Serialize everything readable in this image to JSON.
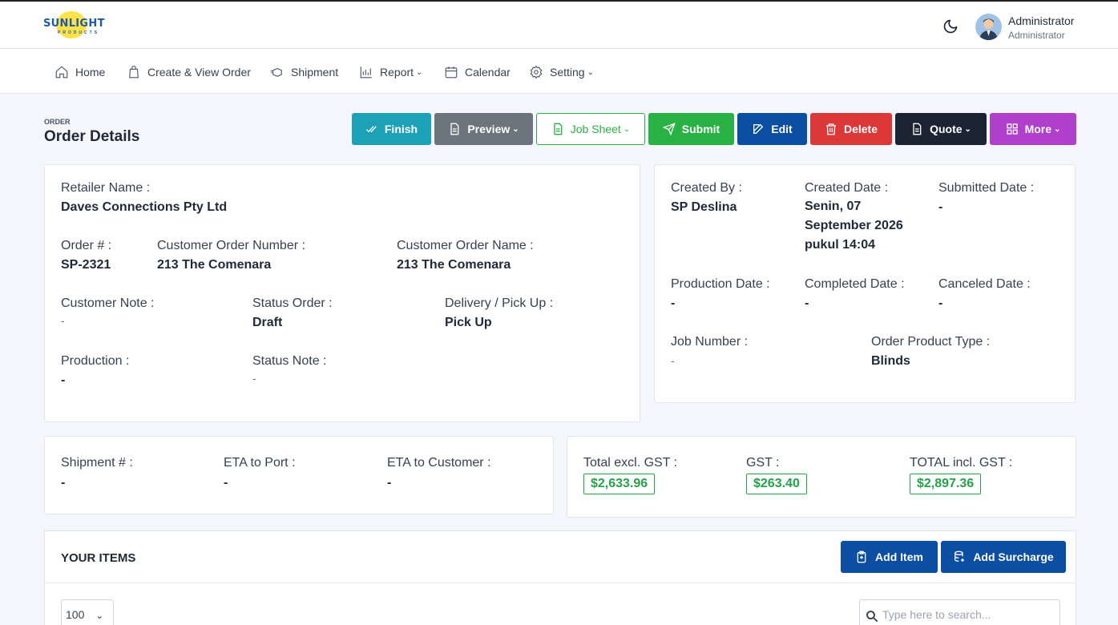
{
  "brand": {
    "name": "SUNLIGHT",
    "tagline": "PRODUCTS"
  },
  "user": {
    "name": "Administrator",
    "role": "Administrator"
  },
  "nav": {
    "home": "Home",
    "orders": "Create & View Order",
    "shipment": "Shipment",
    "report": "Report",
    "calendar": "Calendar",
    "setting": "Setting"
  },
  "page": {
    "breadcrumb": "ORDER",
    "title": "Order Details"
  },
  "actions": {
    "finish": "Finish",
    "preview": "Preview",
    "job_sheet": "Job Sheet",
    "submit": "Submit",
    "edit": "Edit",
    "delete": "Delete",
    "quote": "Quote",
    "more": "More"
  },
  "order": {
    "retailer_label": "Retailer Name :",
    "retailer_value": "Daves Connections Pty Ltd",
    "order_no_label": "Order # :",
    "order_no_value": "SP-2321",
    "cust_order_number_label": "Customer Order Number :",
    "cust_order_number_value": "213 The Comenara",
    "cust_order_name_label": "Customer Order Name :",
    "cust_order_name_value": "213 The Comenara",
    "customer_note_label": "Customer Note :",
    "customer_note_value": "-",
    "status_order_label": "Status Order :",
    "status_order_value": "Draft",
    "delivery_label": "Delivery / Pick Up :",
    "delivery_value": "Pick Up",
    "production_label": "Production :",
    "production_value": "-",
    "status_note_label": "Status Note :",
    "status_note_value": "-"
  },
  "meta": {
    "created_by_label": "Created By :",
    "created_by_value": "SP Deslina",
    "created_date_label": "Created Date :",
    "created_date_value": "Senin, 07 September 2026 pukul 14:04",
    "submitted_date_label": "Submitted Date :",
    "submitted_date_value": "-",
    "production_date_label": "Production Date :",
    "production_date_value": "-",
    "completed_date_label": "Completed Date :",
    "completed_date_value": "-",
    "canceled_date_label": "Canceled Date :",
    "canceled_date_value": "-",
    "job_number_label": "Job Number :",
    "job_number_value": "-",
    "product_type_label": "Order Product Type :",
    "product_type_value": "Blinds"
  },
  "shipment": {
    "shipment_label": "Shipment # :",
    "shipment_value": "-",
    "eta_port_label": "ETA to Port :",
    "eta_port_value": "-",
    "eta_customer_label": "ETA to Customer :",
    "eta_customer_value": "-"
  },
  "totals": {
    "excl_label": "Total excl. GST :",
    "excl_value": "$2,633.96",
    "gst_label": "GST :",
    "gst_value": "$263.40",
    "incl_label": "TOTAL incl. GST :",
    "incl_value": "$2,897.36"
  },
  "items": {
    "title": "YOUR ITEMS",
    "add_item": "Add Item",
    "add_surcharge": "Add Surcharge",
    "page_size": "100",
    "search_placeholder": "Type here to search..."
  },
  "colors": {
    "finish": "#1da1b7",
    "preview": "#6c757d",
    "submit": "#2ab144",
    "edit": "#0b4ea2",
    "delete": "#dc3838",
    "quote": "#1c2434",
    "more": "#b03fcb",
    "money": "#22a447"
  }
}
